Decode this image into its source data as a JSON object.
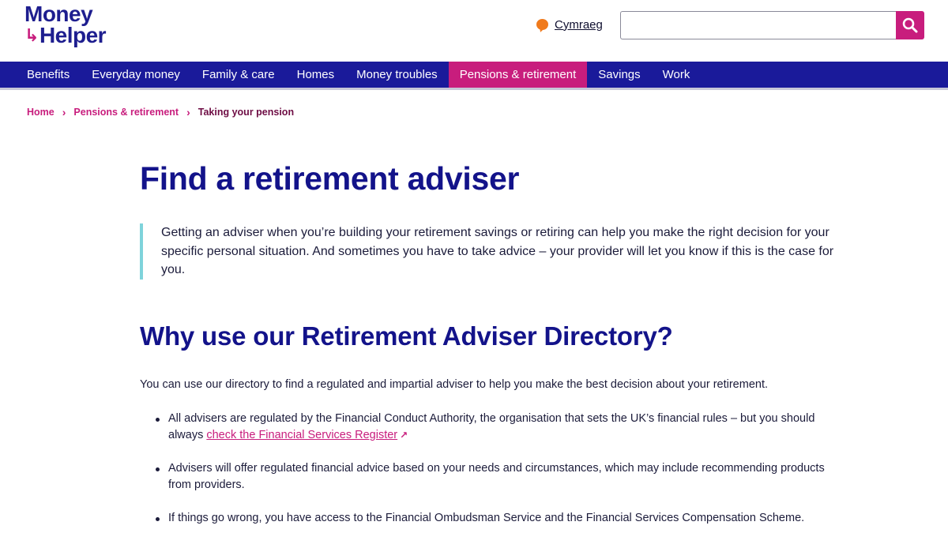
{
  "header": {
    "logo_line1": "Money",
    "logo_line2": "Helper",
    "language_link": "Cymraeg",
    "search": {
      "value": "",
      "placeholder": ""
    }
  },
  "nav": {
    "items": [
      {
        "label": "Benefits"
      },
      {
        "label": "Everyday money"
      },
      {
        "label": "Family & care"
      },
      {
        "label": "Homes"
      },
      {
        "label": "Money troubles"
      },
      {
        "label": "Pensions & retirement",
        "active": true
      },
      {
        "label": "Savings"
      },
      {
        "label": "Work"
      }
    ]
  },
  "breadcrumb": {
    "items": [
      {
        "label": "Home"
      },
      {
        "label": "Pensions & retirement"
      },
      {
        "label": "Taking your pension"
      }
    ]
  },
  "main": {
    "title": "Find a retirement adviser",
    "intro": "Getting an adviser when you’re building your retirement savings or retiring can help you make the right decision for your specific personal situation. And sometimes you have to take advice – your provider will let you know if this is the case for you.",
    "subtitle": "Why use our Retirement Adviser Directory?",
    "paragraph": "You can use our directory to find a regulated and impartial adviser to help you make the best decision about your retirement.",
    "bullets": [
      {
        "text": "All advisers are regulated by the Financial Conduct Authority, the organisation that sets the UK’s financial rules – but you should always ",
        "link": "check the Financial Services Register"
      },
      {
        "text": "Advisers will offer regulated financial advice based on your needs and circumstances, which may include recommending products from providers."
      },
      {
        "text": "If things go wrong, you have access to the Financial Ombudsman Service and the Financial Services Compensation Scheme."
      }
    ]
  },
  "colors": {
    "brand_navy": "#1a1a9a",
    "brand_pink": "#c81d7d",
    "quote_border": "#7fd3db"
  },
  "icons": {
    "search": "search-icon",
    "language": "speech-bubble-icon",
    "breadcrumb_separator": "chevron-right-icon",
    "external_link": "external-link-icon"
  }
}
